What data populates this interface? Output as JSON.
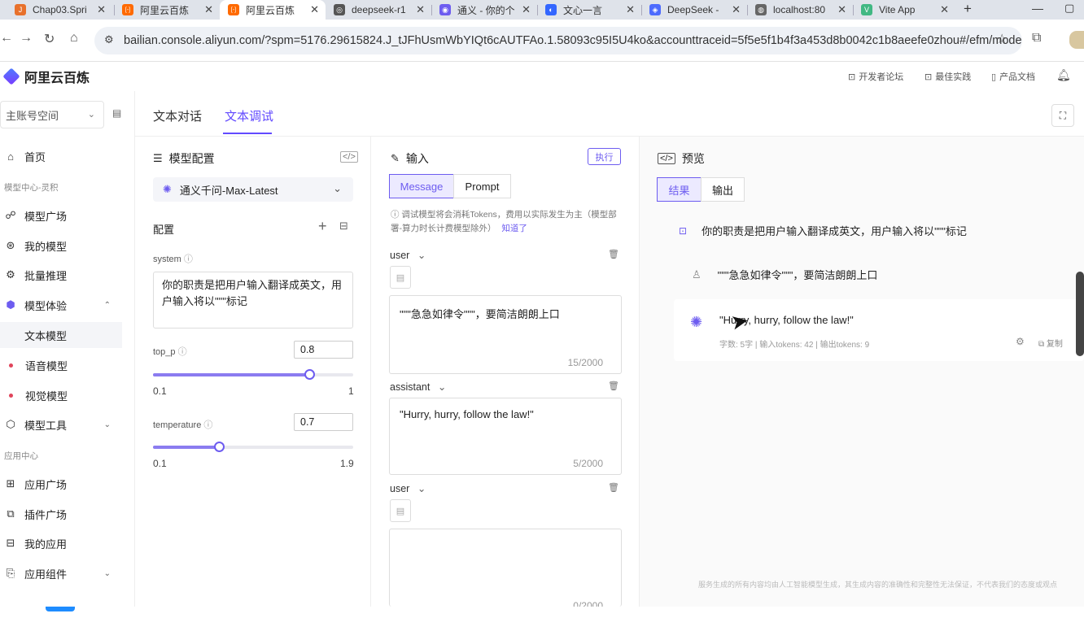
{
  "browser": {
    "tabs": [
      {
        "title": "Chap03.Spri",
        "color": "#e8712c",
        "glyph": "J"
      },
      {
        "title": "阿里云百炼",
        "color": "#ff6a00",
        "glyph": "[-]"
      },
      {
        "title": "阿里云百炼",
        "color": "#ff6a00",
        "glyph": "[-]"
      },
      {
        "title": "deepseek-r1",
        "color": "#555555",
        "glyph": "◎"
      },
      {
        "title": "通义 - 你的个",
        "color": "#6d5cf0",
        "glyph": "◉"
      },
      {
        "title": "文心一言",
        "color": "#3366ff",
        "glyph": "◐"
      },
      {
        "title": "DeepSeek -",
        "color": "#4d6bfe",
        "glyph": "◈"
      },
      {
        "title": "localhost:80",
        "color": "#666666",
        "glyph": "◍"
      },
      {
        "title": "Vite App",
        "color": "#41b883",
        "glyph": "V"
      }
    ],
    "url": "bailian.console.aliyun.com/?spm=5176.29615824.J_tJFhUsmWbYIQt6cAUTFAo.1.58093c95I5U4ko&accounttraceid=5f5e5f1b4f3a453d8b0042c1b8aeefe0zhou#/efm/model_..."
  },
  "header": {
    "logo": "阿里云百炼",
    "links": [
      "开发者论坛",
      "最佳实践",
      "产品文档"
    ]
  },
  "sidebar": {
    "workspace": "主账号空间",
    "items": [
      {
        "label": "首页",
        "icon": "⌂"
      },
      {
        "header": "模型中心-灵积"
      },
      {
        "label": "模型广场",
        "icon": "☍"
      },
      {
        "label": "我的模型",
        "icon": "⊛"
      },
      {
        "label": "批量推理",
        "icon": "⚙"
      },
      {
        "label": "模型体验",
        "icon": "⬢",
        "chev": "⌃"
      },
      {
        "label": "文本模型",
        "sub": true,
        "selected": true
      },
      {
        "label": "语音模型",
        "dot": true
      },
      {
        "label": "视觉模型",
        "dot": true
      },
      {
        "label": "模型工具",
        "icon": "⬡",
        "chev": "⌄"
      },
      {
        "header": "应用中心"
      },
      {
        "label": "应用广场",
        "icon": "⊞"
      },
      {
        "label": "插件广场",
        "icon": "⧉"
      },
      {
        "label": "我的应用",
        "icon": "⊟"
      },
      {
        "label": "应用组件",
        "icon": "⎘",
        "chev": "⌄"
      }
    ]
  },
  "subtabs": [
    "文本对话",
    "文本调试"
  ],
  "config": {
    "title": "模型配置",
    "model": "通义千问-Max-Latest",
    "section": "配置",
    "system_label": "system",
    "system_value": "你的职责是把用户输入翻译成英文，用户输入将以\"\"\"标记",
    "top_p": {
      "label": "top_p",
      "value": "0.8",
      "min": "0.1",
      "max": "1",
      "fraction": 0.78
    },
    "temperature": {
      "label": "temperature",
      "value": "0.7",
      "min": "0.1",
      "max": "1.9",
      "fraction": 0.33
    }
  },
  "input": {
    "title": "输入",
    "run": "执行",
    "modes": [
      "Message",
      "Prompt"
    ],
    "notice": "调试模型将会消耗Tokens，费用以实际发生为主（模型部署-算力时长计费模型除外）",
    "notice_link": "知道了",
    "messages": [
      {
        "role": "user",
        "text": "\"\"\"急急如律令\"\"\"，要简洁朗朗上口",
        "count": "15/2000"
      },
      {
        "role": "assistant",
        "text": "\"Hurry, hurry, follow the law!\"",
        "count": "5/2000"
      },
      {
        "role": "user",
        "text": "",
        "count": "0/2000"
      }
    ]
  },
  "preview": {
    "title": "预览",
    "tabs": [
      "结果",
      "输出"
    ],
    "system_msg": "你的职责是把用户输入翻译成英文，用户输入将以\"\"\"标记",
    "user_msg": "\"\"\"急急如律令\"\"\"，要简洁朗朗上口",
    "reply": "\"Hurry, hurry, follow the law!\"",
    "stats": [
      "字数: 5字",
      "输入tokens: 42",
      "输出tokens: 9"
    ],
    "copy": "复制",
    "footnote": "服务生成的所有内容均由人工智能模型生成，其生成内容的准确性和完整性无法保证，不代表我们的态度或观点"
  },
  "colors": {
    "accent": "#6d5cf0"
  }
}
